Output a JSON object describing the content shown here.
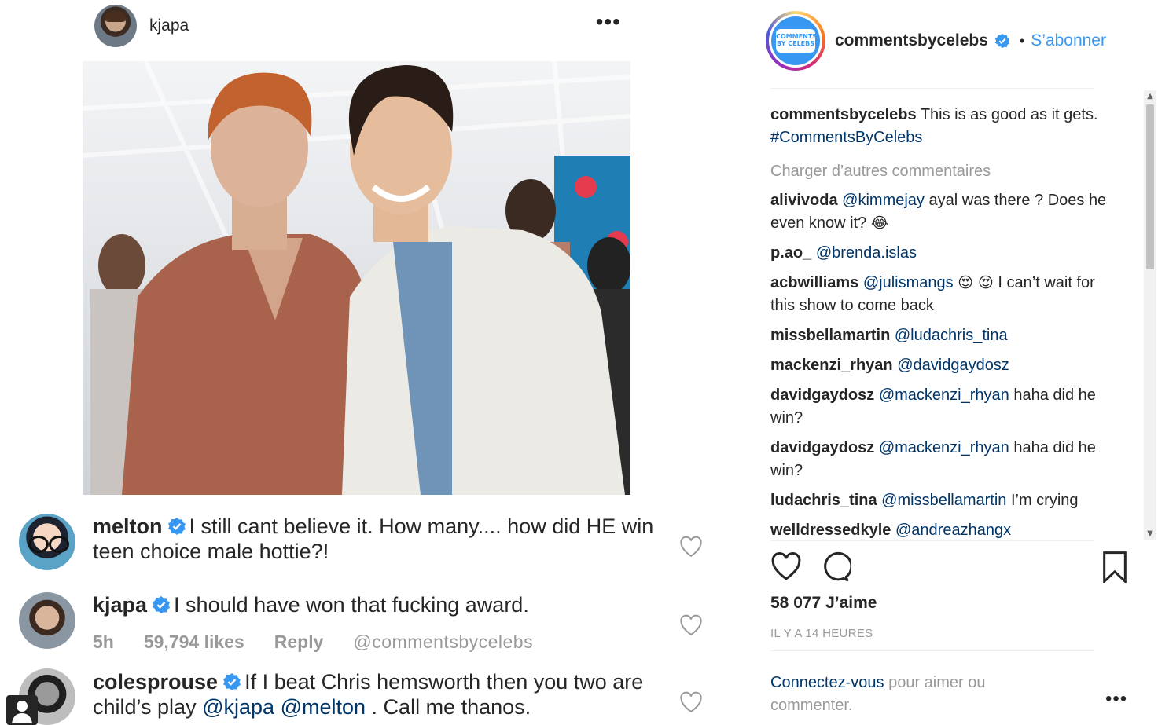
{
  "post": {
    "username": "kjapa",
    "more_icon": "more-dots-icon",
    "comments": [
      {
        "username": "melton",
        "text": "I still cant believe it. How many.... how did HE win teen choice male hottie?!"
      },
      {
        "username": "kjapa",
        "text": "I should have won that fucking award.",
        "time": "5h",
        "likes": "59,794 likes",
        "reply": "Reply",
        "watermark": "@commentsbycelebs"
      },
      {
        "username": "colesprouse",
        "text_before": "If I beat Chris hemsworth then you two are child’s play",
        "mention1": "@kjapa",
        "mention2": "@melton",
        "text_after": ". Call me thanos."
      }
    ]
  },
  "sidebar": {
    "username": "commentsbycelebs",
    "separator": "•",
    "follow_label": "S’abonner",
    "logo_text": "COMMENTS BY CELEBS",
    "caption": {
      "username": "commentsbycelebs",
      "text": "This is as good as it gets.",
      "hashtag": "#CommentsByCelebs"
    },
    "load_more": "Charger d’autres commentaires",
    "comments": [
      {
        "username": "alivivoda",
        "mention": "@kimmejay",
        "text": "ayal was there ? Does he even know it?",
        "emoji": "😂"
      },
      {
        "username": "p.ao_",
        "mention": "@brenda.islas",
        "text": ""
      },
      {
        "username": "acbwilliams",
        "mention": "@julismangs",
        "emoji": "😍 😍",
        "text": "I can’t wait for this show to come back"
      },
      {
        "username": "missbellamartin",
        "mention": "@ludachris_tina",
        "text": ""
      },
      {
        "username": "mackenzi_rhyan",
        "mention": "@davidgaydosz",
        "text": ""
      },
      {
        "username": "davidgaydosz",
        "mention": "@mackenzi_rhyan",
        "text": "haha did he win?"
      },
      {
        "username": "davidgaydosz",
        "mention": "@mackenzi_rhyan",
        "text": "haha did he win?"
      },
      {
        "username": "ludachris_tina",
        "mention": "@missbellamartin",
        "text": "I’m crying"
      },
      {
        "username": "welldressedkyle",
        "mention": "@andreazhangx",
        "text": ""
      }
    ],
    "likes": "58 077 J’aime",
    "time": "IL Y A 14 HEURES",
    "login_link": "Connectez-vous",
    "login_text": "pour aimer ou commenter.",
    "more_icon": "more-dots-icon"
  },
  "colors": {
    "link": "#003569",
    "follow": "#3897f0",
    "verified": "#3897f0",
    "muted": "#999999",
    "text": "#262626"
  }
}
